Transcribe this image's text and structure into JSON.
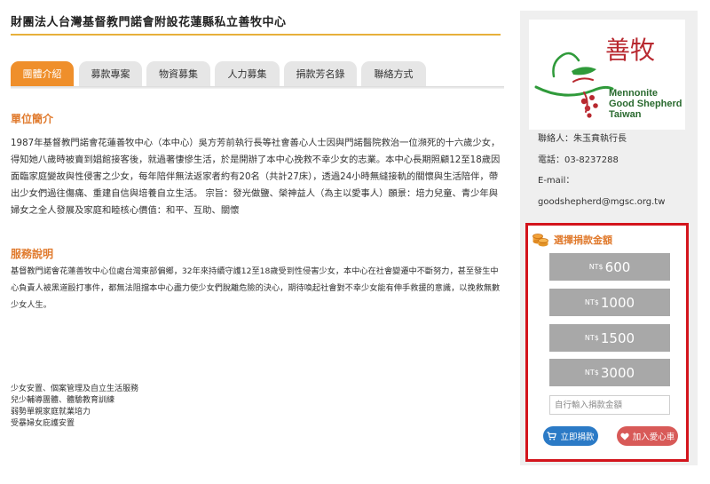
{
  "org_title": "財團法人台灣基督教門諾會附設花蓮縣私立善牧中心",
  "tabs": [
    "團體介紹",
    "募款專案",
    "物資募集",
    "人力募集",
    "捐款芳名錄",
    "聯絡方式"
  ],
  "sections": {
    "intro_title": "單位簡介",
    "intro_text": "1987年基督教門諾會花蓮善牧中心（本中心）吳方芳前執行長等社會善心人士因與門諾醫院救治一位瀕死的十六歲少女，得知她八歲時被賣到娼館接客後，就過著悽慘生活，於是開辦了本中心挽救不幸少女的志業。本中心長期照顧12至18歲因面臨家庭變故與性侵害之少女，每年陪伴無法返家者約有20名（共計27床），透過24小時無縫接軌的關懷與生活陪伴，帶出少女們過往傷痛、重建自信與培養自立生活。 宗旨：發光做鹽、榮神益人（為主以愛事人）願景：培力兒童、青少年與婦女之全人發展及家庭和睦核心價值：和平、互助、關懷",
    "service_title": "服務說明",
    "service_text": "基督教門諾會花蓮善牧中心位處台灣東部偏鄉，32年來持續守護12至18歲受到性侵害少女，本中心在社會變遷中不斷努力，甚至發生中心負責人被黑道毆打事件，都無法阻擋本中心盡力使少女們脫離危險的決心，期待喚起社會對不幸少女能有伸手救援的意識，以挽救無數少女人生。",
    "services": [
      "少女安置、個案管理及自立生活服務",
      "兒少輔導團體、體驗教育訓練",
      "弱勢單親家庭就業培力",
      "受暴婦女庇護安置"
    ]
  },
  "logo": {
    "chinese": "善牧",
    "english_1": "Mennonite",
    "english_2": "Good Shepherd",
    "english_3": "Taiwan"
  },
  "contact": {
    "person": "聯絡人：朱玉賁執行長",
    "phone": "電話：03-8237288",
    "email_label": "E-mail：",
    "email": "goodshepherd@mgsc.org.tw"
  },
  "donation": {
    "heading": "選擇捐款金額",
    "currency": "NT$",
    "amounts": [
      "600",
      "1000",
      "1500",
      "3000"
    ],
    "placeholder": "自行輸入捐款金額",
    "give_label": "立即捐款",
    "cart_label": "加入愛心車"
  },
  "colors": {
    "accent_orange": "#ef8f2b",
    "section_title": "#e07a2d",
    "highlight_border": "#d3141c",
    "amount_button": "#a8a8a8",
    "give_button": "#2b7ac6",
    "cart_button": "#d85a58"
  }
}
